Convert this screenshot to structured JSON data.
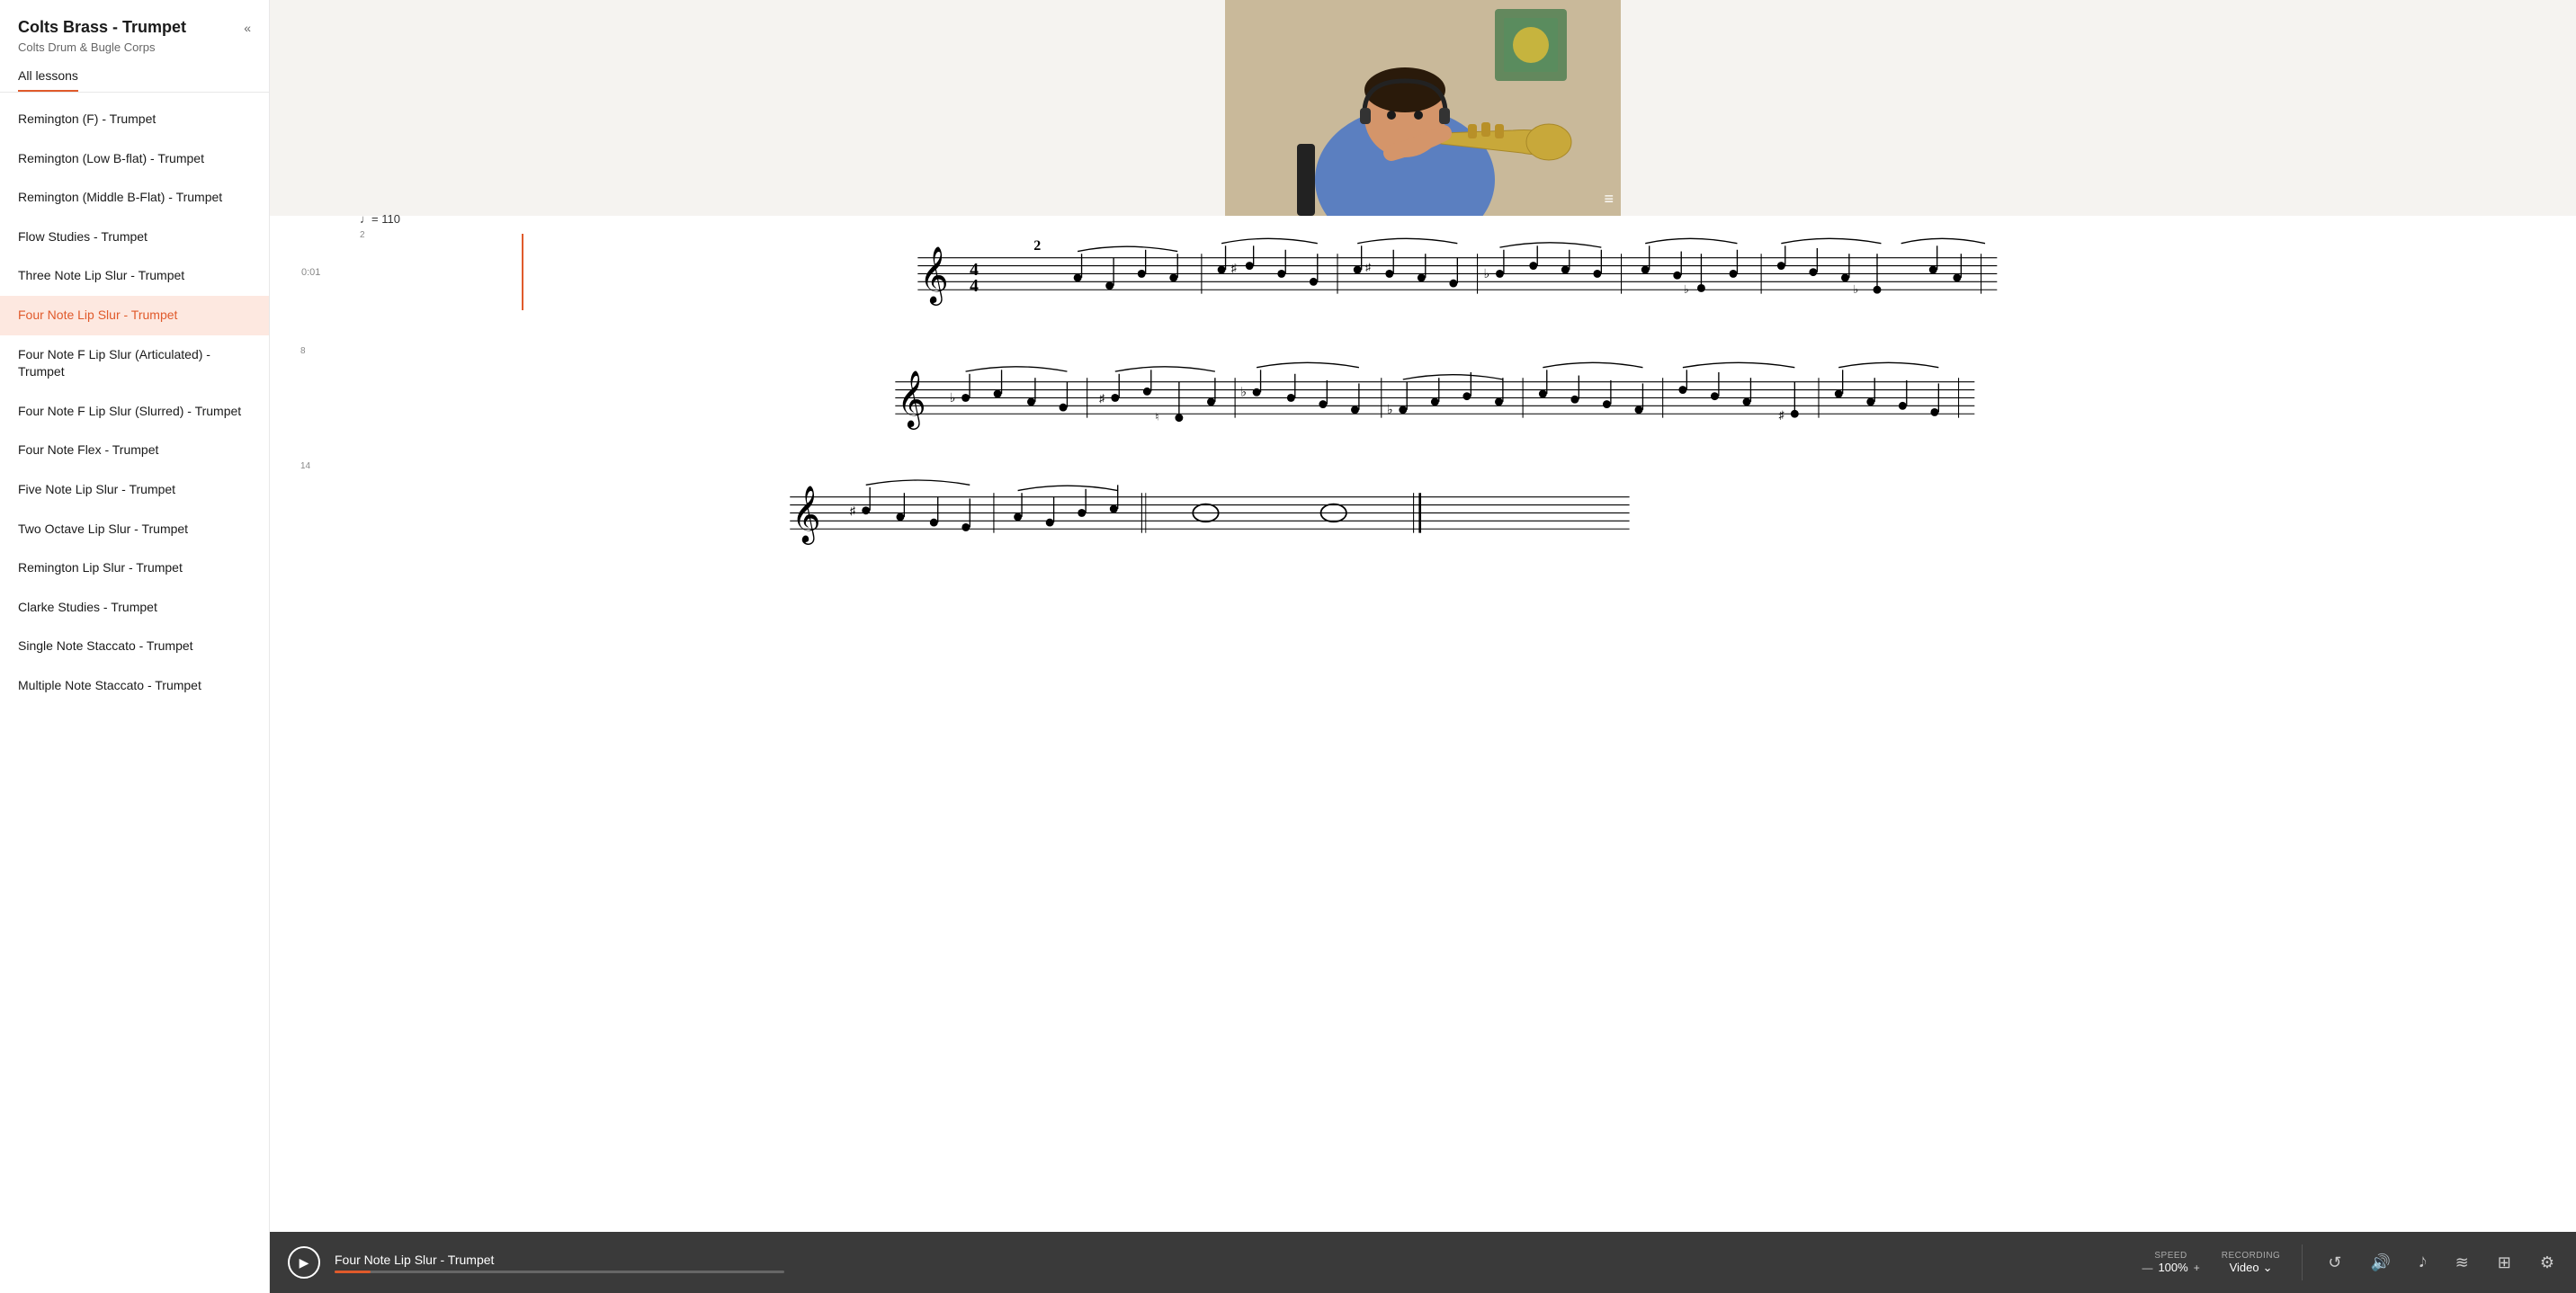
{
  "sidebar": {
    "title": "Colts Brass - Trumpet",
    "subtitle": "Colts Drum & Bugle Corps",
    "collapse_label": "«",
    "tab_label": "All lessons",
    "items": [
      {
        "id": "remington-f",
        "label": "Remington (F) - Trumpet",
        "active": false
      },
      {
        "id": "remington-low-bb",
        "label": "Remington (Low B-flat) - Trumpet",
        "active": false
      },
      {
        "id": "remington-middle-bf",
        "label": "Remington (Middle B-Flat) - Trumpet",
        "active": false
      },
      {
        "id": "flow-studies",
        "label": "Flow Studies - Trumpet",
        "active": false
      },
      {
        "id": "three-note-lip-slur",
        "label": "Three Note Lip Slur - Trumpet",
        "active": false
      },
      {
        "id": "four-note-lip-slur",
        "label": "Four Note Lip Slur - Trumpet",
        "active": true
      },
      {
        "id": "four-note-f-lip-slur-articulated",
        "label": "Four Note F Lip Slur (Articulated) - Trumpet",
        "active": false
      },
      {
        "id": "four-note-f-lip-slur-slurred",
        "label": "Four Note F Lip Slur (Slurred) - Trumpet",
        "active": false
      },
      {
        "id": "four-note-flex",
        "label": "Four Note Flex - Trumpet",
        "active": false
      },
      {
        "id": "five-note-lip-slur",
        "label": "Five Note Lip Slur - Trumpet",
        "active": false
      },
      {
        "id": "two-octave-lip-slur",
        "label": "Two Octave Lip Slur - Trumpet",
        "active": false
      },
      {
        "id": "remington-lip-slur",
        "label": "Remington Lip Slur - Trumpet",
        "active": false
      },
      {
        "id": "clarke-studies",
        "label": "Clarke Studies - Trumpet",
        "active": false
      },
      {
        "id": "single-note-staccato",
        "label": "Single Note Staccato - Trumpet",
        "active": false
      },
      {
        "id": "multiple-note-staccato",
        "label": "Multiple Note Staccato - Trumpet",
        "active": false
      }
    ]
  },
  "player": {
    "track_name": "Four Note Lip Slur - Trumpet",
    "speed_label": "SPEED",
    "speed_minus": "—",
    "speed_value": "100%",
    "speed_plus": "+",
    "recording_label": "RECORDING",
    "recording_value": "Video",
    "recording_chevron": "⌄"
  },
  "sheet": {
    "tempo": "♩= 110",
    "time_marker": "0:01",
    "measure_numbers": [
      "2",
      "8",
      "14"
    ]
  },
  "icons": {
    "collapse": "«",
    "play": "▶",
    "loop": "↺",
    "volume": "🔊",
    "metronome": "♩",
    "waveform": "≋",
    "grid": "⊞",
    "settings": "⚙"
  }
}
